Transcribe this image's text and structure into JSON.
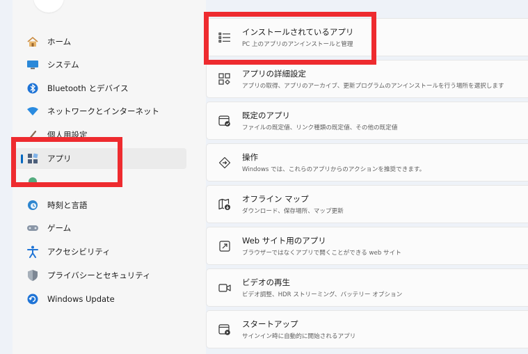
{
  "sidebar": {
    "items": [
      {
        "label": "ホーム",
        "icon": "home-icon"
      },
      {
        "label": "システム",
        "icon": "system-icon"
      },
      {
        "label": "Bluetooth とデバイス",
        "icon": "bluetooth-icon"
      },
      {
        "label": "ネットワークとインターネット",
        "icon": "network-icon"
      },
      {
        "label": "個人用設定",
        "icon": "personalization-icon"
      },
      {
        "label": "アプリ",
        "icon": "apps-icon"
      },
      {
        "label": "",
        "icon": "accounts-icon"
      },
      {
        "label": "時刻と言語",
        "icon": "time-language-icon"
      },
      {
        "label": "ゲーム",
        "icon": "gaming-icon"
      },
      {
        "label": "アクセシビリティ",
        "icon": "accessibility-icon"
      },
      {
        "label": "プライバシーとセキュリティ",
        "icon": "privacy-shield-icon"
      },
      {
        "label": "Windows Update",
        "icon": "windows-update-icon"
      }
    ]
  },
  "main": {
    "cards": [
      {
        "title": "インストールされているアプリ",
        "subtitle": "PC 上のアプリのアンインストールと管理",
        "icon": "list-icon"
      },
      {
        "title": "アプリの詳細設定",
        "subtitle": "アプリの取得、アプリのアーカイブ、更新プログラムのアンインストールを行う場所を選択します",
        "icon": "app-settings-icon"
      },
      {
        "title": "既定のアプリ",
        "subtitle": "ファイルの既定値、リンク種類の既定値、その他の既定値",
        "icon": "default-apps-icon"
      },
      {
        "title": "操作",
        "subtitle": "Windows では、これらのアプリからのアクションを推奨できます。",
        "icon": "actions-icon"
      },
      {
        "title": "オフライン マップ",
        "subtitle": "ダウンロード、保存場所、マップ更新",
        "icon": "offline-map-icon"
      },
      {
        "title": "Web サイト用のアプリ",
        "subtitle": "ブラウザーではなくアプリで開くことができる web サイト",
        "icon": "open-external-icon"
      },
      {
        "title": "ビデオの再生",
        "subtitle": "ビデオ調整、HDR ストリーミング、バッテリー オプション",
        "icon": "video-icon"
      },
      {
        "title": "スタートアップ",
        "subtitle": "サインイン時に自動的に開始されるアプリ",
        "icon": "startup-icon"
      }
    ]
  },
  "colors": {
    "accent": "#0067c0",
    "highlight": "#ee2b2f",
    "card_bg": "#fbfbfb",
    "sidebar_bg": "#f6f6f6",
    "page_bg": "#eef2f8"
  }
}
